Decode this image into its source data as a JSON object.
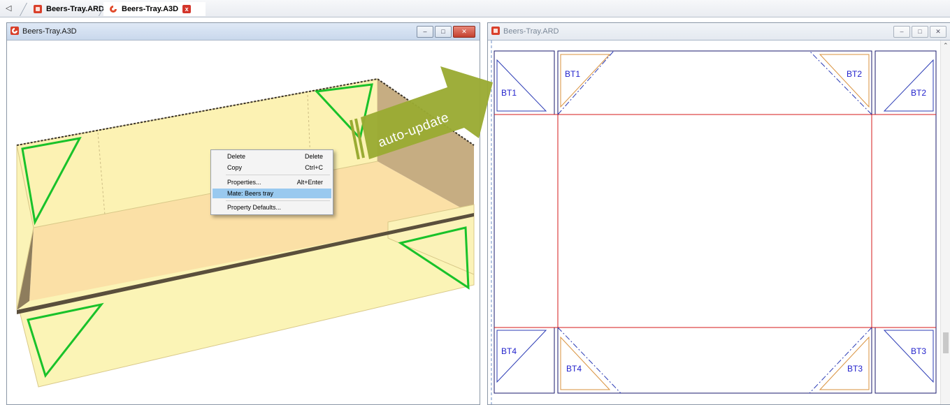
{
  "tabs": [
    {
      "label": "Beers-Tray.ARD",
      "icon": "ard-file-icon"
    },
    {
      "label": "Beers-Tray.A3D",
      "icon": "a3d-file-icon",
      "active": true
    }
  ],
  "tab_scroll_glyph": "◁",
  "tab_close_glyph": "x",
  "left_window": {
    "title": "Beers-Tray.A3D",
    "buttons": {
      "minimize": "–",
      "maximize": "□",
      "close": "✕"
    }
  },
  "right_window": {
    "title": "Beers-Tray.ARD",
    "buttons": {
      "minimize": "–",
      "maximize": "□",
      "close": "✕"
    }
  },
  "context_menu": {
    "items": [
      {
        "label": "Delete",
        "shortcut": "Delete"
      },
      {
        "label": "Copy",
        "shortcut": "Ctrl+C"
      },
      {
        "label": "Properties...",
        "shortcut": "Alt+Enter"
      },
      {
        "label": "Mate: Beers tray",
        "shortcut": "",
        "highlighted": true
      },
      {
        "label": "Property Defaults...",
        "shortcut": ""
      }
    ]
  },
  "callout": {
    "text": "auto-update",
    "color": "#9aab33"
  },
  "flat_labels": {
    "bt1_side": "BT1",
    "bt1_flap": "BT1",
    "bt2_flap": "BT2",
    "bt2_side": "BT2",
    "bt4_side": "BT4",
    "bt4_flap": "BT4",
    "bt3_flap": "BT3",
    "bt3_side": "BT3"
  },
  "colors": {
    "tray_light": "#fbf4b6",
    "tray_inner": "#fbe4a8",
    "tray_side": "#b8a07a",
    "triangle": "#19c22a",
    "cut_line": "#1a1a6e",
    "crease_line": "#d51a1a",
    "flap_outline": "#d9923e"
  },
  "scroll_up_glyph": "⌃"
}
